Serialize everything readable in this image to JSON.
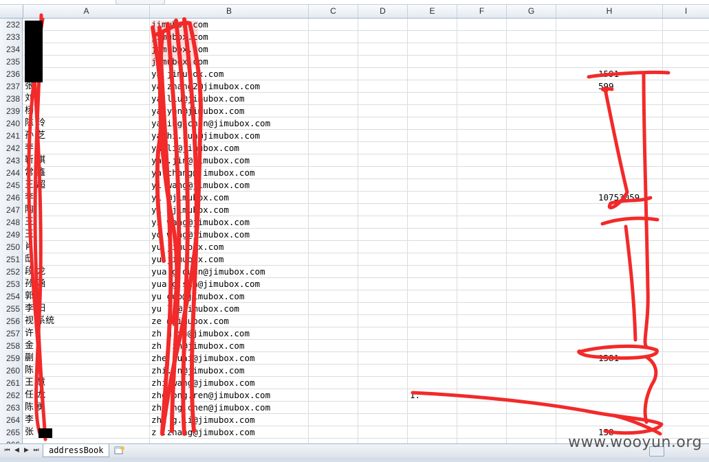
{
  "columns": [
    "A",
    "B",
    "C",
    "D",
    "E",
    "F",
    "G",
    "H",
    "I"
  ],
  "rows": [
    {
      "num": "232",
      "a": "",
      "b": "jimubox.com",
      "e": "",
      "h": ""
    },
    {
      "num": "233",
      "a": "",
      "b": "jimubox.com",
      "e": "",
      "h": ""
    },
    {
      "num": "234",
      "a": "",
      "b": "jimubox.com",
      "e": "",
      "h": ""
    },
    {
      "num": "235",
      "a": "",
      "b": "jimubox.com",
      "e": "",
      "h": ""
    },
    {
      "num": "236",
      "a": "",
      "b": "ya jimubox.com",
      "e": "",
      "h": "1591"
    },
    {
      "num": "237",
      "a": "张",
      "b": "ya zhang2@jimubox.com",
      "e": "",
      "h": "599"
    },
    {
      "num": "238",
      "a": "刘",
      "b": "ya liu@jimubox.com",
      "e": "",
      "h": ""
    },
    {
      "num": "239",
      "a": "杨",
      "b": "ya yan@jimubox.com",
      "e": "",
      "h": ""
    },
    {
      "num": "240",
      "a": "陈 玲",
      "b": "ya ing.chen@jimubox.com",
      "e": "",
      "h": ""
    },
    {
      "num": "241",
      "a": "孙 芝",
      "b": "ya hi.sun@jimubox.com",
      "e": "",
      "h": ""
    },
    {
      "num": "242",
      "a": "李",
      "b": "ya li@jimubox.com",
      "e": "",
      "h": ""
    },
    {
      "num": "243",
      "a": "靳 棋",
      "b": "ya .jin@jimubox.com",
      "e": "",
      "h": ""
    },
    {
      "num": "244",
      "a": "常 鑫",
      "b": "ya chang@jimubox.com",
      "e": "",
      "h": ""
    },
    {
      "num": "245",
      "a": "王 超",
      "b": "yi wang@jimubox.com",
      "e": "",
      "h": ""
    },
    {
      "num": "246",
      "a": "李",
      "b": "yi @jimubox.com",
      "e": "",
      "h": "10753059"
    },
    {
      "num": "247",
      "a": "陶",
      "b": "yi @jimubox.com",
      "e": "",
      "h": ""
    },
    {
      "num": "248",
      "a": "王",
      "b": "yi wang@jimubox.com",
      "e": "",
      "h": ""
    },
    {
      "num": "249",
      "a": "王",
      "b": "yo wang@jimubox.com",
      "e": "",
      "h": ""
    },
    {
      "num": "250",
      "a": "肖",
      "b": "yu jimubox.com",
      "e": "",
      "h": ""
    },
    {
      "num": "251",
      "a": "邸",
      "b": "yu jimubox.com",
      "e": "",
      "h": ""
    },
    {
      "num": "252",
      "a": "段 龙",
      "b": "yua g.duan@jimubox.com",
      "e": "",
      "h": ""
    },
    {
      "num": "253",
      "a": "孙 涵",
      "b": "yua g.sun@jimubox.com",
      "e": "",
      "h": ""
    },
    {
      "num": "254",
      "a": "郭",
      "b": "yu guo@jimubox.com",
      "e": "",
      "h": ""
    },
    {
      "num": "255",
      "a": "李 阳",
      "b": "yu li@jimubox.com",
      "e": "",
      "h": ""
    },
    {
      "num": "256",
      "a": "视 系统",
      "b": "ze @jimubox.com",
      "e": "",
      "h": ""
    },
    {
      "num": "257",
      "a": "许",
      "b": "zh g.xu@jimubox.com",
      "e": "",
      "h": ""
    },
    {
      "num": "258",
      "a": "金",
      "b": "zh jin@jimubox.com",
      "e": "",
      "h": ""
    },
    {
      "num": "259",
      "a": "蒯",
      "b": "zhe kuai@jimubox.com",
      "e": "",
      "h": "1581"
    },
    {
      "num": "260",
      "a": "陈",
      "b": "zhi. n@jimubox.com",
      "e": "",
      "h": ""
    },
    {
      "num": "261",
      "a": "王 慧",
      "b": "zhi wang@jimubox.com",
      "e": "",
      "h": ""
    },
    {
      "num": "262",
      "a": "任 龙",
      "b": "zho ong.ren@jimubox.com",
      "e": "1.",
      "h": ""
    },
    {
      "num": "263",
      "a": "陈 勇",
      "b": "zho ng.chen@jimubox.com",
      "e": "",
      "h": ""
    },
    {
      "num": "264",
      "a": "李",
      "b": "zhu g.li@jimubox.com",
      "e": "",
      "h": ""
    },
    {
      "num": "265",
      "a": "张",
      "b": "z .zhang@jimubox.com",
      "e": "",
      "h": "158"
    },
    {
      "num": "266",
      "a": "",
      "b": "",
      "e": "",
      "h": ""
    }
  ],
  "sheet_tab": "addressBook",
  "watermark": "www.wooyun.org",
  "nav_icons": [
    "first-sheet-icon",
    "prev-sheet-icon",
    "next-sheet-icon",
    "last-sheet-icon"
  ],
  "colors": {
    "redaction": "#f22a2a",
    "grid": "#dadcdd",
    "header": "#e4eaf2"
  }
}
